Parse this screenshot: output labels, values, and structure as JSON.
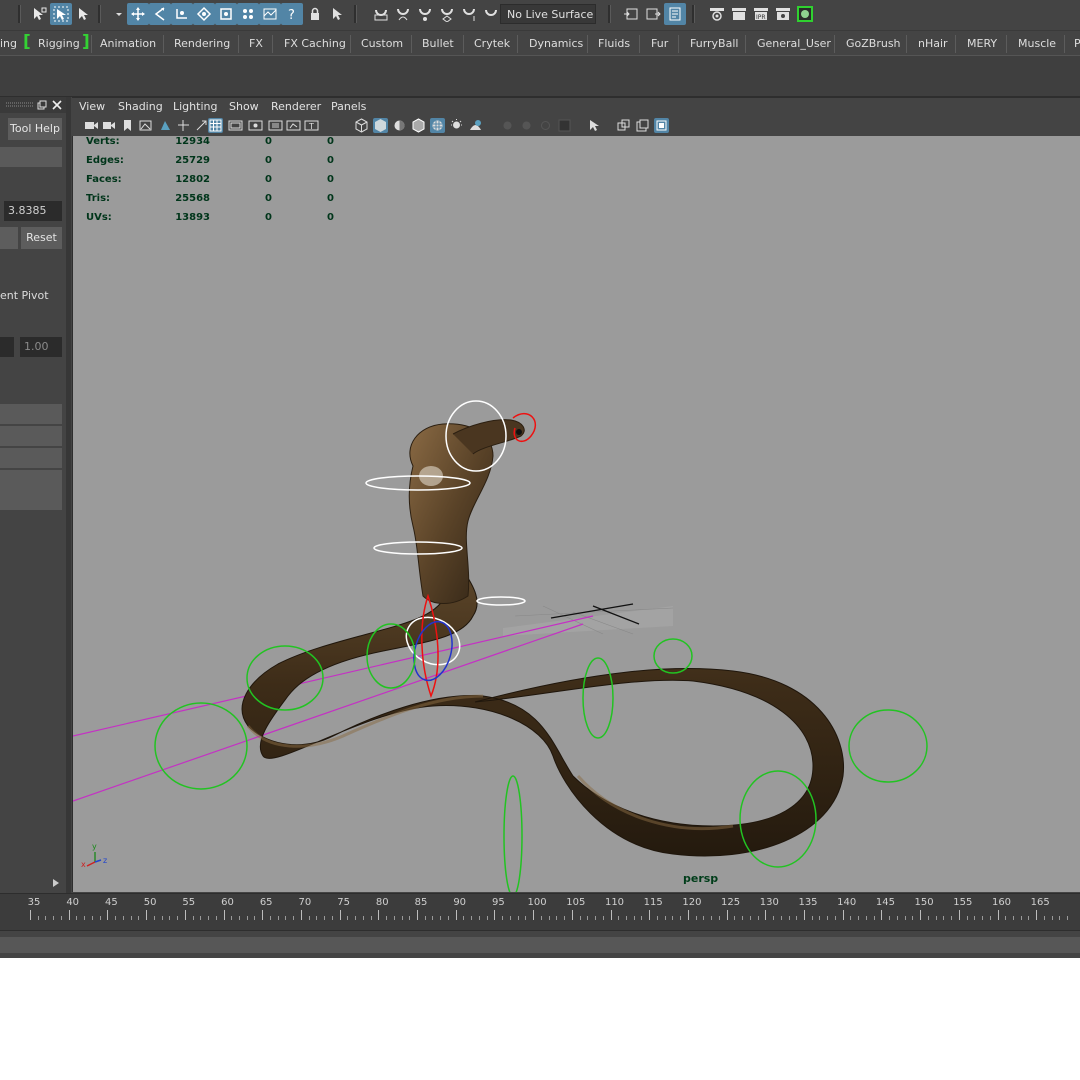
{
  "status_line": {
    "live_surface": "No Live Surface",
    "tools_left": [
      "select-tool-icon",
      "lasso-tool-icon",
      "paint-select-icon"
    ],
    "snap_tools": [
      "snap-grid-icon",
      "snap-curve-icon",
      "snap-point-icon",
      "snap-view-plane-icon",
      "snap-live-icon",
      "make-live-icon"
    ],
    "render_icons": [
      "render-current-icon",
      "ipr-render-icon",
      "render-settings-icon",
      "hypershade-icon"
    ]
  },
  "shelf_tabs": [
    "ing",
    "Rigging",
    "Animation",
    "Rendering",
    "FX",
    "FX Caching",
    "Custom",
    "Bullet",
    "Crytek",
    "Dynamics",
    "Fluids",
    "Fur",
    "FurryBall",
    "General_User",
    "GoZBrush",
    "nHair",
    "MERY",
    "Muscle",
    "P"
  ],
  "tool_settings": {
    "tool_help": "Tool Help",
    "value_field": "3.8385",
    "reset": "Reset",
    "pivot_label": "ent Pivot",
    "scale_field": "1.00"
  },
  "viewport_menu": [
    "View",
    "Shading",
    "Lighting",
    "Show",
    "Renderer",
    "Panels"
  ],
  "hud": {
    "rows": [
      {
        "label": "Verts:",
        "values": [
          "12934",
          "0",
          "0"
        ]
      },
      {
        "label": "Edges:",
        "values": [
          "25729",
          "0",
          "0"
        ]
      },
      {
        "label": "Faces:",
        "values": [
          "12802",
          "0",
          "0"
        ]
      },
      {
        "label": "Tris:",
        "values": [
          "25568",
          "0",
          "0"
        ]
      },
      {
        "label": "UVs:",
        "values": [
          "13893",
          "0",
          "0"
        ]
      }
    ]
  },
  "camera_label": "persp",
  "axis": {
    "x": "x",
    "y": "y",
    "z": "z"
  },
  "time_slider": {
    "ticks": [
      "35",
      "40",
      "45",
      "50",
      "55",
      "60",
      "65",
      "70",
      "75",
      "80",
      "85",
      "90",
      "95",
      "100",
      "105",
      "110",
      "115",
      "120",
      "125",
      "130",
      "135",
      "140",
      "145",
      "150",
      "155",
      "160",
      "165"
    ]
  },
  "colors": {
    "accent_blue": "#5285a6",
    "viewport_bg": "#9b9b9b",
    "control_green": "#22c322",
    "hud_text": "#00351a"
  }
}
